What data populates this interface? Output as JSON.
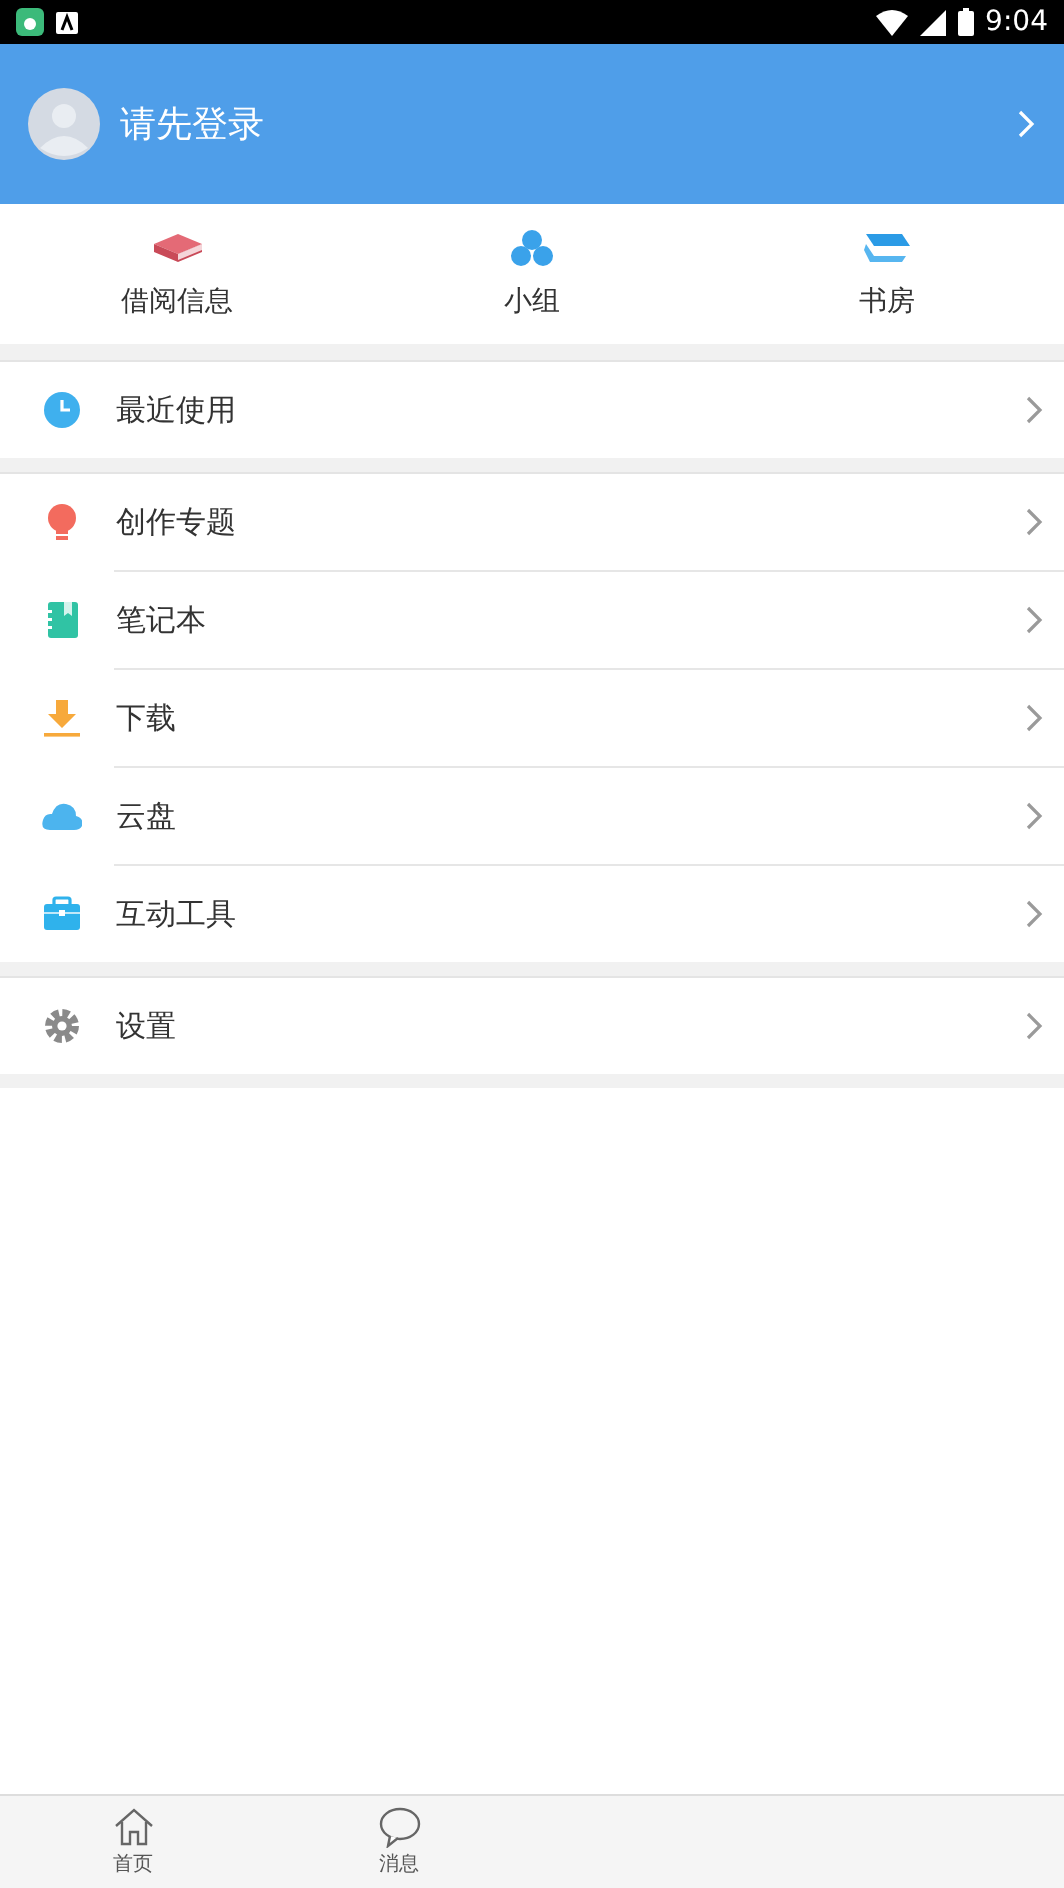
{
  "status_bar": {
    "time": "9:04"
  },
  "profile": {
    "label": "请先登录"
  },
  "shortcuts": [
    {
      "label": "借阅信息"
    },
    {
      "label": "小组"
    },
    {
      "label": "书房"
    }
  ],
  "menu_groups": [
    {
      "items": [
        {
          "label": "最近使用"
        }
      ]
    },
    {
      "items": [
        {
          "label": "创作专题"
        },
        {
          "label": "笔记本"
        },
        {
          "label": "下载"
        },
        {
          "label": "云盘"
        },
        {
          "label": "互动工具"
        }
      ]
    },
    {
      "items": [
        {
          "label": "设置"
        }
      ]
    }
  ],
  "bottom_nav": [
    {
      "label": "首页"
    },
    {
      "label": "消息"
    }
  ]
}
